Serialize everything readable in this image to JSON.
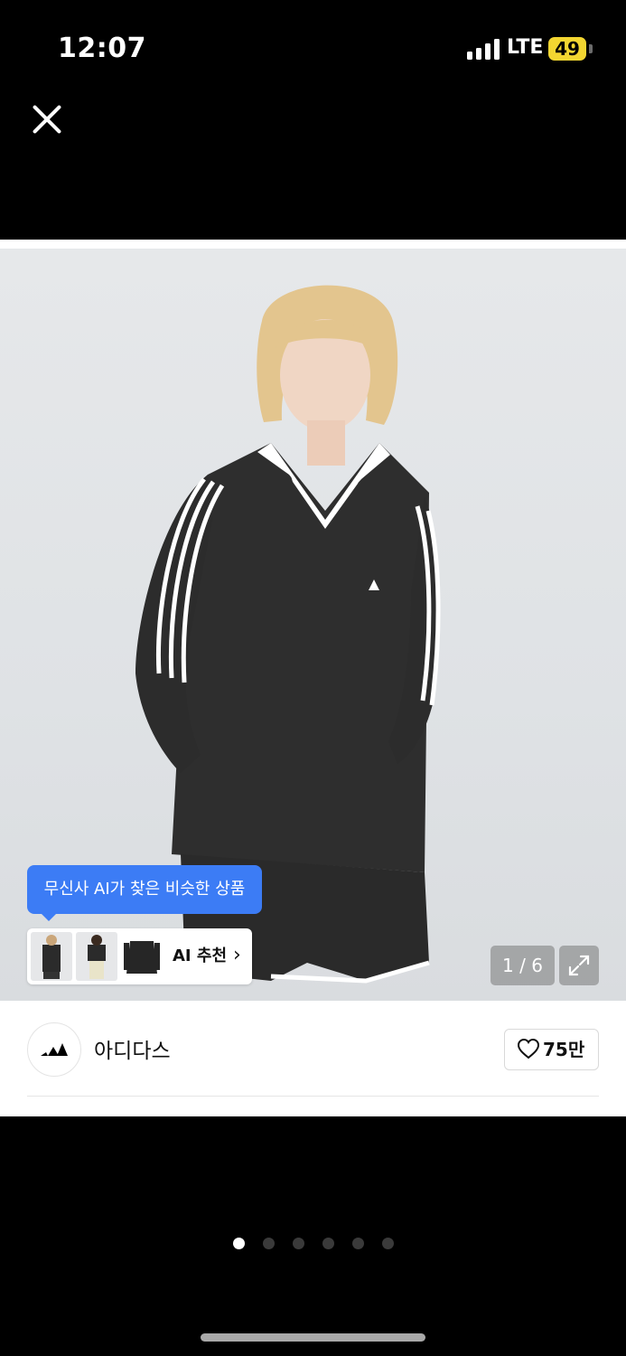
{
  "status_bar": {
    "time": "12:07",
    "network": "LTE",
    "battery": "49"
  },
  "viewer": {
    "ai_tooltip": "무신사 AI가 찾은 비슷한 상품",
    "ai_recommend_label": "AI 추천",
    "counter": "1 / 6",
    "current_page": 1,
    "total_pages": 6
  },
  "brand": {
    "name": "아디다스",
    "likes": "75만"
  },
  "icons": {
    "close": "close-icon",
    "expand": "expand-icon",
    "heart": "heart-icon",
    "chevron": "chevron-right-icon",
    "brand_logo": "adidas-logo"
  },
  "colors": {
    "accent": "#3c7cf5",
    "background": "#000000",
    "card": "#ffffff"
  }
}
